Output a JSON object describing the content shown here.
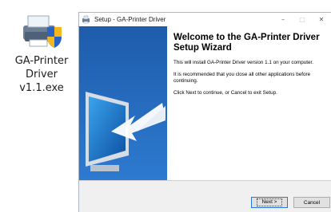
{
  "desktop": {
    "file_icon": "printer-installer-icon",
    "file_name": "GA-Printer\nDriver\nv1.1.exe"
  },
  "window": {
    "title": "Setup - GA-Printer Driver",
    "controls": {
      "minimize": "–",
      "maximize": "□",
      "close": "✕"
    },
    "heading": "Welcome to the GA-Printer Driver Setup Wizard",
    "paragraphs": [
      "This will install GA-Printer Driver version 1.1 on your computer.",
      "It is recommended that you close all other applications before continuing.",
      "Click Next to continue, or Cancel to exit Setup."
    ],
    "buttons": {
      "next": "Next >",
      "cancel": "Cancel"
    }
  },
  "colors": {
    "banner": "#1f63b3",
    "accent": "#2a78d6",
    "window_bg": "#f0f0f0"
  }
}
